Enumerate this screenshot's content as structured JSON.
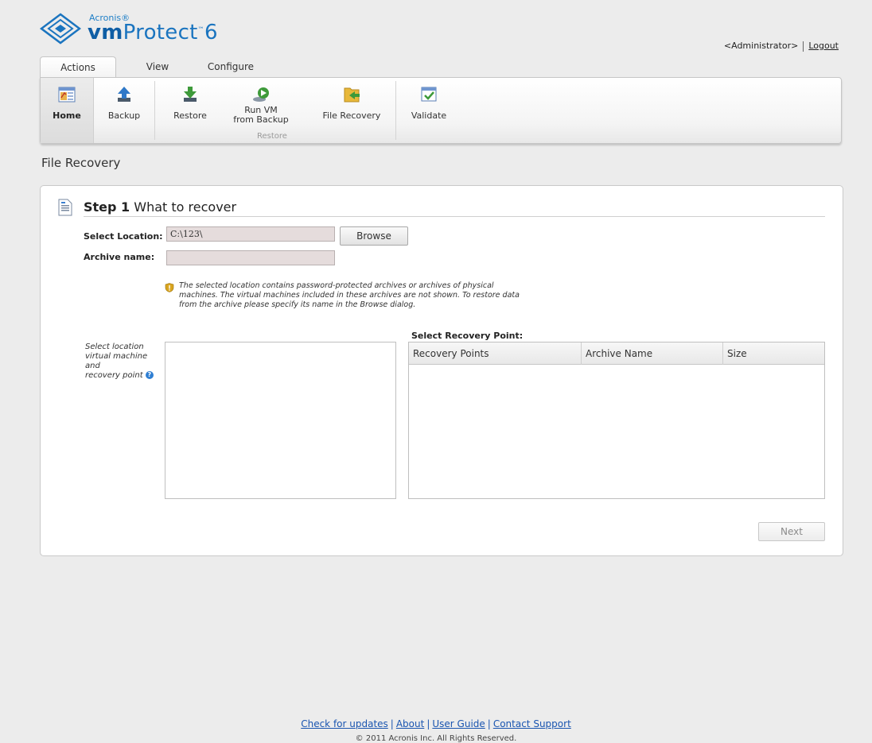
{
  "header": {
    "brand_small": "Acronis®",
    "product_bold": "vm",
    "product_rest": "Protect",
    "product_version": "6",
    "user": "<Administrator>",
    "logout": "Logout"
  },
  "tabs": [
    {
      "label": "Actions",
      "active": true
    },
    {
      "label": "View",
      "active": false
    },
    {
      "label": "Configure",
      "active": false
    }
  ],
  "ribbon": {
    "home": "Home",
    "backup": "Backup",
    "restore": "Restore",
    "run_vm_line1": "Run VM",
    "run_vm_line2": "from Backup",
    "file_recovery": "File Recovery",
    "validate": "Validate",
    "group_restore": "Restore"
  },
  "page": {
    "title": "File Recovery"
  },
  "step": {
    "number": "Step 1",
    "title": "What to recover"
  },
  "form": {
    "location_label": "Select Location:",
    "location_value": "C:\\123\\",
    "browse": "Browse",
    "archive_label": "Archive name:",
    "archive_value": ""
  },
  "warning": {
    "line1": "The selected location contains password-protected archives or archives of physical",
    "line2": "machines. The virtual machines included in these archives are not shown. To restore data",
    "line3": "from the archive please specify its name in the Browse dialog."
  },
  "selector": {
    "side_line1": "Select location",
    "side_line2": "virtual machine and",
    "side_line3": "recovery point",
    "recovery_point_title": "Select Recovery Point:",
    "columns": [
      "Recovery Points",
      "Archive Name",
      "Size"
    ],
    "rows": []
  },
  "actions": {
    "next": "Next"
  },
  "footer": {
    "links": [
      "Check for updates",
      "About",
      "User Guide",
      "Contact Support"
    ],
    "copyright": "© 2011 Acronis Inc. All Rights Reserved."
  },
  "colors": {
    "brand_blue": "#1a74bf",
    "link_blue": "#1a55b0",
    "input_bg": "#e5dcdc"
  }
}
